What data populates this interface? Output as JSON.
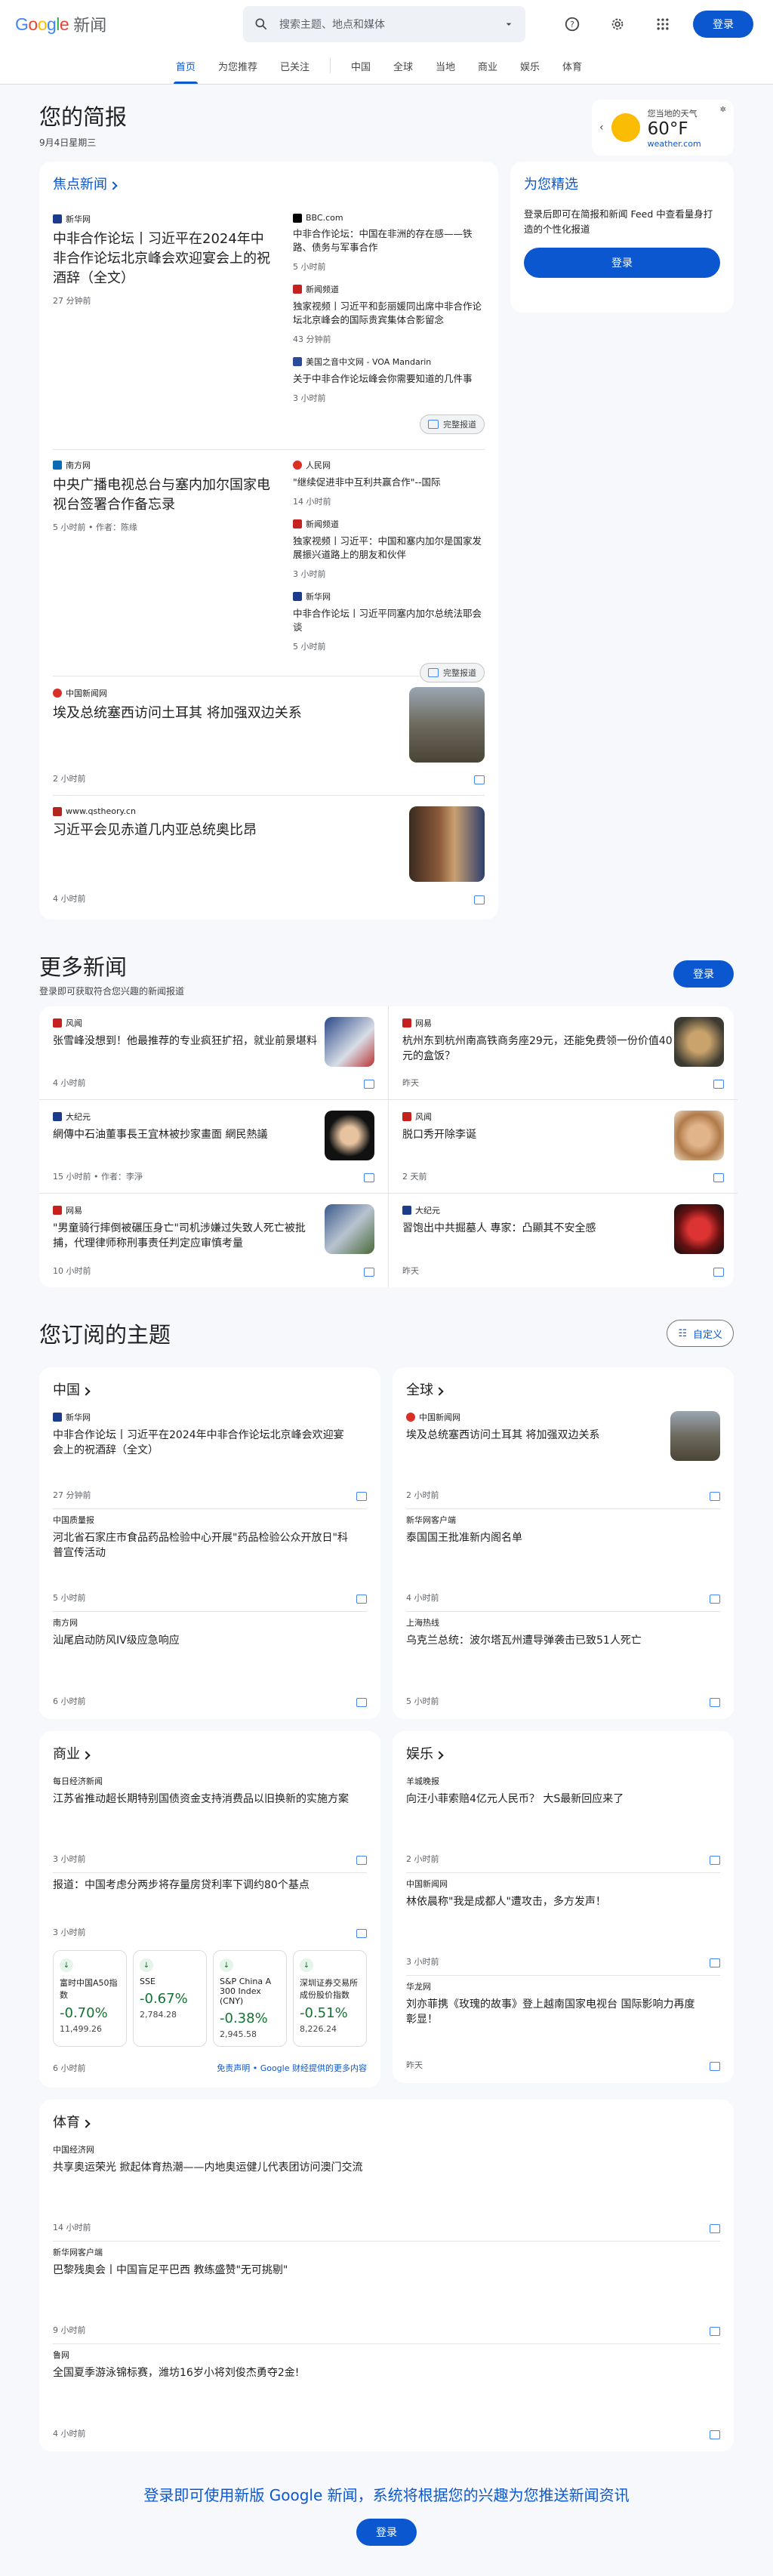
{
  "header": {
    "logo_google": "Google",
    "logo_news": "新闻",
    "search_placeholder": "搜索主题、地点和媒体",
    "signin": "登录"
  },
  "nav": {
    "tabs": [
      "首页",
      "为您推荐",
      "已关注",
      "中国",
      "全球",
      "当地",
      "商业",
      "娱乐",
      "体育"
    ],
    "active": "首页"
  },
  "brief": {
    "title": "您的简报",
    "date": "9月4日星期三"
  },
  "weather": {
    "location": "您当地的天气",
    "temp": "60°F",
    "source": "weather.com"
  },
  "top_stories": {
    "label": "焦点新闻",
    "clusters": [
      {
        "main": {
          "source": "新华网",
          "title": "中非合作论坛丨习近平在2024年中非合作论坛北京峰会欢迎宴会上的祝酒辞（全文）",
          "meta": "27 分钟前"
        },
        "subs": [
          {
            "source": "BBC.com",
            "title": "中非合作论坛：中国在非洲的存在感——铁路、债务与军事合作",
            "meta": "5 小时前"
          },
          {
            "source": "新闻频道",
            "title": "独家视频丨习近平和彭丽媛同出席中非合作论坛北京峰会的国际贵宾集体合影留念",
            "meta": "43 分钟前"
          },
          {
            "source": "美国之音中文网 - VOA Mandarin",
            "title": "关于中非合作论坛峰会你需要知道的几件事",
            "meta": "3 小时前"
          }
        ],
        "full": "完整报道"
      },
      {
        "main": {
          "source": "南方网",
          "title": "中央广播电视总台与塞内加尔国家电视台签署合作备忘录",
          "meta": "5 小时前 • 作者：陈缘"
        },
        "subs": [
          {
            "source": "人民网",
            "title": "\"继续促进非中互利共赢合作\"--国际",
            "meta": "14 小时前"
          },
          {
            "source": "新闻频道",
            "title": "独家视频丨习近平：中国和塞内加尔是国家发展振兴道路上的朋友和伙伴",
            "meta": "3 小时前"
          },
          {
            "source": "新华网",
            "title": "中非合作论坛丨习近平同塞内加尔总统法耶会谈",
            "meta": "5 小时前"
          }
        ],
        "full": "完整报道"
      }
    ],
    "singles": [
      {
        "source": "中国新闻网",
        "title": "埃及总统塞西访问土耳其 将加强双边关系",
        "meta": "2 小时前"
      },
      {
        "source": "www.qstheory.cn",
        "title": "习近平会见赤道几内亚总统奥比昂",
        "meta": "4 小时前"
      }
    ]
  },
  "picks": {
    "title": "为您精选",
    "text": "登录后即可在简报和新闻 Feed 中查看量身打造的个性化报道",
    "button": "登录"
  },
  "more": {
    "title": "更多新闻",
    "subtitle": "登录即可获取符合您兴趣的新闻报道",
    "button": "登录",
    "items": [
      {
        "source": "风闻",
        "title": "张雪峰没想到！他最推荐的专业疯狂扩招，就业前景堪料",
        "meta": "4 小时前"
      },
      {
        "source": "网易",
        "title": "杭州东到杭州南高铁商务座29元，还能免费领一份价值40元的盒饭？",
        "meta": "昨天"
      },
      {
        "source": "大纪元",
        "title": "網傳中石油董事長王宜林被抄家畫面 網民熱議",
        "meta": "15 小时前 • 作者：李淨"
      },
      {
        "source": "风闻",
        "title": "脱口秀开除李诞",
        "meta": "2 天前"
      },
      {
        "source": "网易",
        "title": "\"男童骑行摔倒被碾压身亡\"司机涉嫌过失致人死亡被批捕，代理律师称刑事责任判定应审慎考量",
        "meta": "10 小时前"
      },
      {
        "source": "大纪元",
        "title": "習饱出中共掘墓人 專家：凸顯其不安全感",
        "meta": "昨天"
      }
    ]
  },
  "subscribed": {
    "title": "您订阅的主题",
    "customize": "自定义",
    "topics": [
      {
        "name": "中国",
        "items": [
          {
            "source": "新华网",
            "title": "中非合作论坛丨习近平在2024年中非合作论坛北京峰会欢迎宴会上的祝酒辞（全文）",
            "meta": "27 分钟前"
          },
          {
            "source": "中国质量报",
            "title": "河北省石家庄市食品药品检验中心开展\"药品检验公众开放日\"科普宣传活动",
            "meta": "5 小时前"
          },
          {
            "source": "南方网",
            "title": "汕尾启动防风IV级应急响应",
            "meta": "6 小时前"
          }
        ]
      },
      {
        "name": "全球",
        "items": [
          {
            "source": "中国新闻网",
            "title": "埃及总统塞西访问土耳其 将加强双边关系",
            "meta": "2 小时前"
          },
          {
            "source": "新华网客户端",
            "title": "泰国国王批准新内阁名单",
            "meta": "4 小时前"
          },
          {
            "source": "上海热线",
            "title": "乌克兰总统：波尔塔瓦州遭导弹袭击已致51人死亡",
            "meta": "5 小时前"
          }
        ]
      },
      {
        "name": "商业",
        "items": [
          {
            "source": "每日经济新闻",
            "title": "江苏省推动超长期特别国债资金支持消费品以旧换新的实施方案",
            "meta": "3 小时前"
          },
          {
            "source": "",
            "title": "报道：中国考虑分两步将存量房贷利率下调约80个基点",
            "meta": "3 小时前"
          }
        ],
        "stocks": [
          {
            "name": "富时中国A50指数",
            "change": "-0.70%",
            "value": "11,499.26"
          },
          {
            "name": "SSE",
            "change": "-0.67%",
            "value": "2,784.28"
          },
          {
            "name": "S&P China A 300 Index (CNY)",
            "change": "-0.38%",
            "value": "2,945.58"
          },
          {
            "name": "深圳证券交易所成份股价指数",
            "change": "-0.51%",
            "value": "8,226.24"
          }
        ],
        "stocks_meta": "6 小时前",
        "disclaimer": "免责声明 • Google 财经提供的更多内容"
      },
      {
        "name": "娱乐",
        "items": [
          {
            "source": "羊城晚报",
            "title": "向汪小菲索赔4亿元人民币？ 大S最新回应来了",
            "meta": "2 小时前"
          },
          {
            "source": "中国新闻网",
            "title": "林依晨称\"我是成都人\"遭攻击，多方发声！",
            "meta": "3 小时前"
          },
          {
            "source": "华龙网",
            "title": "刘亦菲携《玫瑰的故事》登上越南国家电视台 国际影响力再度彰显！",
            "meta": "昨天"
          }
        ]
      },
      {
        "name": "体育",
        "items": [
          {
            "source": "中国经济网",
            "title": "共享奥运荣光 掀起体育热潮——内地奥运健儿代表团访问澳门交流",
            "meta": "14 小时前"
          },
          {
            "source": "新华网客户端",
            "title": "巴黎残奥会丨中国盲足平巴西 教练盛赞\"无可挑剔\"",
            "meta": "9 小时前"
          },
          {
            "source": "鲁网",
            "title": "全国夏季游泳锦标赛，潍坊16岁小将刘俊杰勇夺2金!",
            "meta": "4 小时前"
          }
        ]
      }
    ]
  },
  "footer": {
    "cta": "登录即可使用新版 Google 新闻，系统将根据您的兴趣为您推送新闻资讯",
    "button": "登录"
  },
  "colors": {
    "accent": "#0b57d0",
    "bg": "#f6f8fc",
    "down": "#137333"
  }
}
